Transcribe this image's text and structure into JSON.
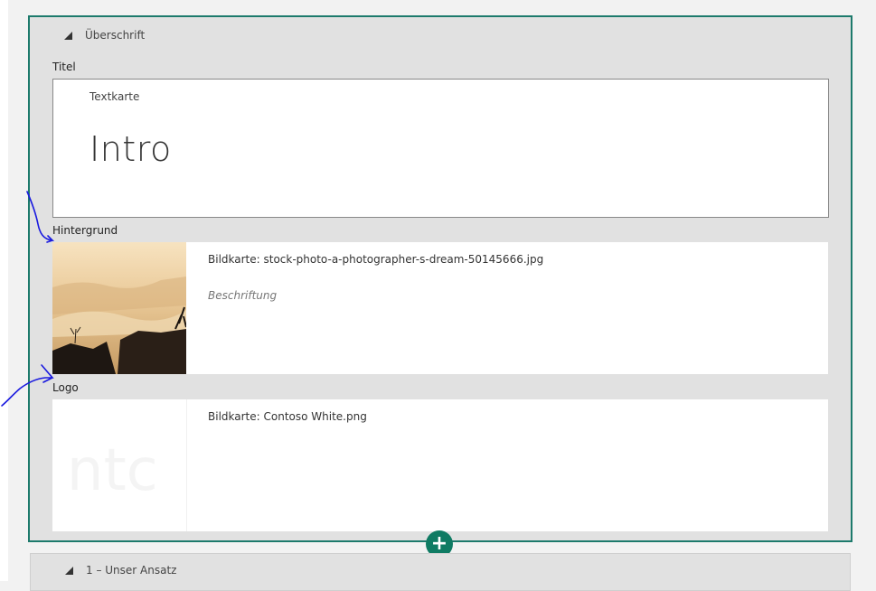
{
  "section": {
    "header": "Überschrift",
    "title_label": "Titel",
    "text_card": {
      "kind": "Textkarte",
      "content": "Intro"
    },
    "background_label": "Hintergrund",
    "background_card": {
      "caption": "Bildkarte: stock-photo-a-photographer-s-dream-50145666.jpg",
      "subtitle": "Beschriftung"
    },
    "logo_label": "Logo",
    "logo_card": {
      "caption": "Bildkarte: Contoso White.png",
      "watermark": "ntc"
    }
  },
  "next_section": {
    "header": "1 – Unser Ansatz"
  },
  "colors": {
    "accent": "#0f7b63",
    "border": "#1d7a6c",
    "ink": "#1a1adf"
  },
  "icons": {
    "collapse": "collapse-triangle-icon",
    "add": "plus-icon"
  }
}
